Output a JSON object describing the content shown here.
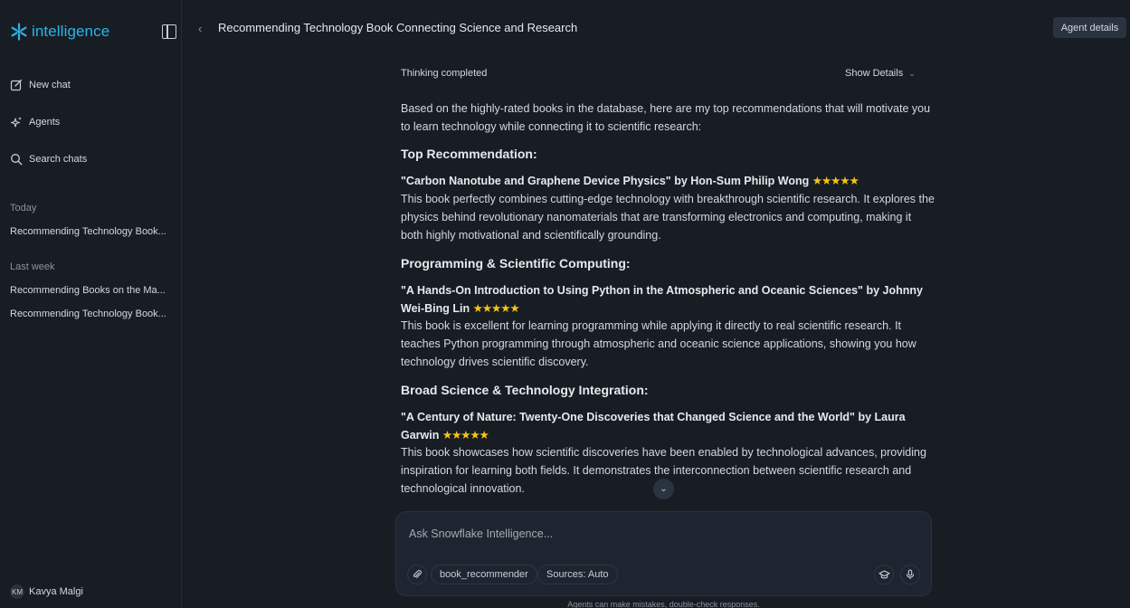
{
  "sidebar": {
    "logo_text": "intelligence",
    "nav": {
      "new_chat": "New chat",
      "agents": "Agents",
      "search_chats": "Search chats"
    },
    "sections": [
      {
        "label": "Today",
        "items": [
          "Recommending Technology Book..."
        ]
      },
      {
        "label": "Last week",
        "items": [
          "Recommending Books on the Ma...",
          "Recommending Technology Book..."
        ]
      }
    ],
    "user": {
      "initials": "KM",
      "name": "Kavya Malgi"
    }
  },
  "header": {
    "title": "Recommending Technology Book Connecting Science and Research",
    "agent_details": "Agent details"
  },
  "message": {
    "thinking_status": "Thinking completed",
    "show_details": "Show Details",
    "intro": "Based on the highly-rated books in the database, here are my top recommendations that will motivate you to learn technology while connecting it to scientific research:",
    "sections": [
      {
        "heading": "Top Recommendation:",
        "book": "\"Carbon Nanotube and Graphene Device Physics\" by Hon-Sum Philip Wong",
        "stars": "★★★★★",
        "description": "This book perfectly combines cutting-edge technology with breakthrough scientific research. It explores the physics behind revolutionary nanomaterials that are transforming electronics and computing, making it both highly motivational and scientifically grounding."
      },
      {
        "heading": "Programming & Scientific Computing:",
        "book": "\"A Hands-On Introduction to Using Python in the Atmospheric and Oceanic Sciences\" by Johnny Wei-Bing Lin",
        "stars": "★★★★★",
        "description": "This book is excellent for learning programming while applying it directly to real scientific research. It teaches Python programming through atmospheric and oceanic science applications, showing you how technology drives scientific discovery."
      },
      {
        "heading": "Broad Science & Technology Integration:",
        "book": "\"A Century of Nature: Twenty-One Discoveries that Changed Science and the World\" by Laura Garwin",
        "stars": "★★★★★",
        "description": "This book showcases how scientific discoveries have been enabled by technological advances, providing inspiration for learning both fields. It demonstrates the interconnection between scientific research and technological innovation."
      }
    ]
  },
  "composer": {
    "placeholder": "Ask Snowflake Intelligence...",
    "agent_pill": "book_recommender",
    "sources_pill": "Sources: Auto"
  },
  "disclaimer": "Agents can make mistakes, double-check responses."
}
